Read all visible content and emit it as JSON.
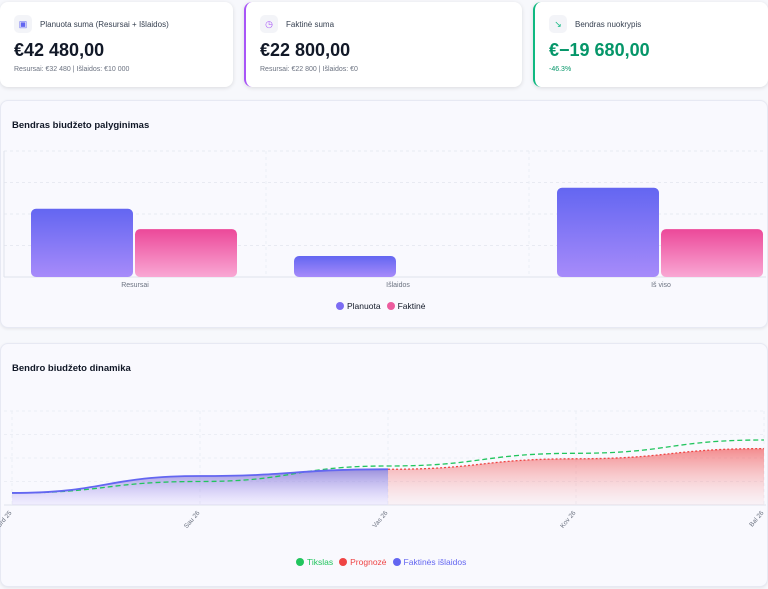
{
  "cards": [
    {
      "title": "Planuota suma (Resursai + Išlaidos)",
      "value": "€42 480,00",
      "sub": "Resursai: €32 480 | Išlaidos: €10 000",
      "icon": "wallet-icon"
    },
    {
      "title": "Faktinė suma",
      "value": "€22 800,00",
      "sub": "Resursai: €22 800 | Išlaidos: €0",
      "icon": "clock-icon",
      "accent": "#a855f7"
    },
    {
      "title": "Bendras nuokrypis",
      "value": "€−19 680,00",
      "sub": "-46.3%",
      "icon": "trending-down-icon",
      "accent": "#10b981"
    }
  ],
  "chart_data": [
    {
      "type": "bar",
      "title": "Bendras biudžeto palyginimas",
      "categories": [
        "Resursai",
        "Išlaidos",
        "Iš viso"
      ],
      "series": [
        {
          "name": "Planuota",
          "values": [
            32480,
            10000,
            42480
          ],
          "color": "#6d62f0"
        },
        {
          "name": "Faktinė",
          "values": [
            22800,
            0,
            22800
          ],
          "color": "#ec4899"
        }
      ],
      "ylim": [
        0,
        60000
      ],
      "grid": true,
      "legend": "bottom"
    },
    {
      "type": "area",
      "title": "Bendro biudžeto dinamika",
      "x": [
        "Grd 25",
        "Sau 26",
        "Vas 26",
        "Kov 26",
        "Bal 26"
      ],
      "series": [
        {
          "name": "Tikslas",
          "values": [
            7700,
            15000,
            24900,
            33000,
            41500
          ],
          "color": "#22c55e",
          "style": "dashed"
        },
        {
          "name": "Prognozė",
          "values": [
            null,
            null,
            22800,
            29500,
            36000
          ],
          "color": "#ef4444",
          "style": "dotted"
        },
        {
          "name": "Faktinės išlaidos",
          "values": [
            7700,
            18500,
            22800,
            null,
            null
          ],
          "color": "#6366f1"
        }
      ],
      "ylim": [
        0,
        60000
      ],
      "grid": true,
      "legend": "bottom"
    }
  ]
}
